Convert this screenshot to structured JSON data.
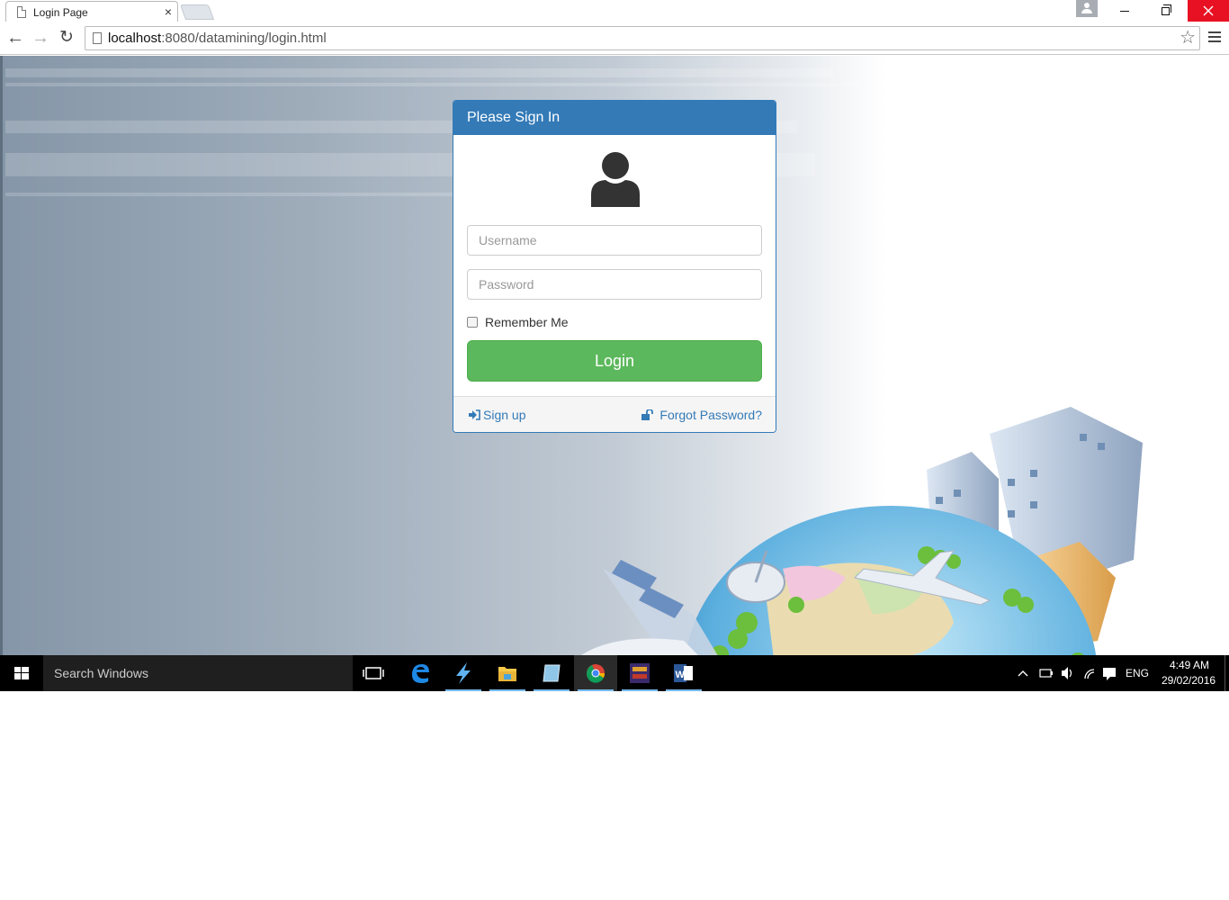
{
  "browser": {
    "tab_title": "Login Page",
    "tab_close": "×",
    "url_host": "localhost",
    "url_rest": ":8080/datamining/login.html",
    "nav": {
      "back": "←",
      "forward": "→",
      "reload": "↻"
    },
    "star": "☆"
  },
  "login": {
    "heading": "Please Sign In",
    "username_placeholder": "Username",
    "password_placeholder": "Password",
    "remember_label": "Remember Me",
    "login_label": "Login",
    "signup_label": "Sign up",
    "forgot_label": "Forgot Password?"
  },
  "taskbar": {
    "search_placeholder": "Search Windows",
    "language": "ENG",
    "time": "4:49 AM",
    "date": "29/02/2016"
  },
  "colors": {
    "panel_primary": "#337ab7",
    "login_button": "#5cb85c",
    "close_button": "#e81123"
  }
}
